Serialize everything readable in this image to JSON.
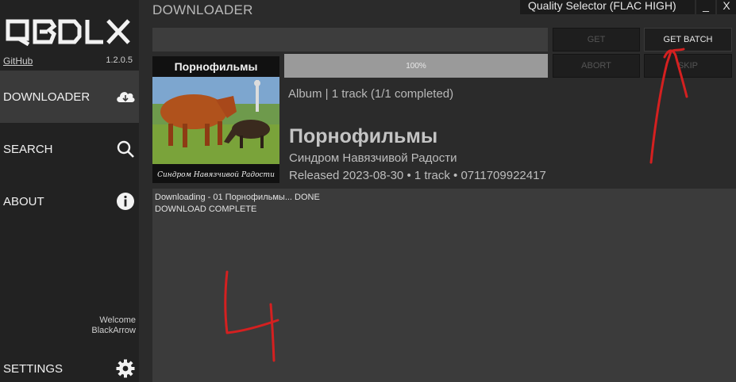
{
  "sidebar": {
    "logo_text": "QBDLX",
    "github_label": "GitHub",
    "version": "1.2.0.5",
    "items": [
      {
        "label": "DOWNLOADER",
        "icon": "cloud-download-icon"
      },
      {
        "label": "SEARCH",
        "icon": "search-icon"
      },
      {
        "label": "ABOUT",
        "icon": "info-icon"
      },
      {
        "label": "SETTINGS",
        "icon": "gear-icon"
      }
    ],
    "welcome_label": "Welcome",
    "username": "BlackArrow"
  },
  "header": {
    "title": "DOWNLOADER",
    "quality_selector": "Quality Selector (FLAC HIGH)",
    "minimize": "_",
    "close": "X"
  },
  "toolbar": {
    "url_value": "",
    "get_label": "GET",
    "get_batch_label": "GET BATCH",
    "abort_label": "ABORT",
    "skip_label": "SKIP",
    "progress_percent": 100,
    "progress_text": "100%"
  },
  "album": {
    "cover_banner": "Порнофильмы",
    "cover_caption": "Синдром Навязчивой Радости",
    "meta": "Album | 1 track (1/1 completed)",
    "title": "Порнофильмы",
    "artist": "Синдром Навязчивой Радости",
    "release": "Released 2023-08-30 • 1 track • 0711709922417"
  },
  "log": {
    "lines": [
      "Downloading - 01 Порнофильмы... DONE",
      "",
      "DOWNLOAD COMPLETE"
    ]
  },
  "annotations": {
    "handwritten_number": "4",
    "color": "#d42020"
  },
  "colors": {
    "sidebar_bg": "#222222",
    "main_bg": "#2b2b2b",
    "active_nav_bg": "#3a3a3a",
    "progress_fill": "#9a9a9a",
    "log_bg": "#3b3b3b"
  }
}
